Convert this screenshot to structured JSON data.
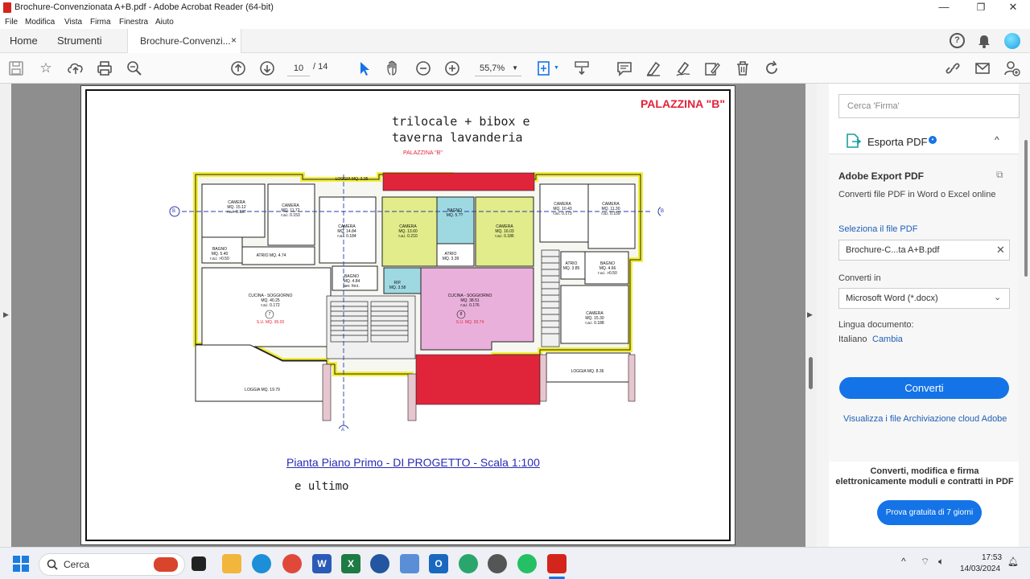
{
  "window": {
    "title": "Brochure-Convenzionata A+B.pdf - Adobe Acrobat Reader (64-bit)",
    "minimize": "—",
    "maximize": "❐",
    "close": "✕"
  },
  "menu": [
    "File",
    "Modifica",
    "Vista",
    "Firma",
    "Finestra",
    "Aiuto"
  ],
  "tabs": {
    "home": "Home",
    "tools": "Strumenti",
    "document": "Brochure-Convenzi...",
    "close": "×"
  },
  "toolbar": {
    "page_current": "10",
    "page_total": "/ 14",
    "zoom": "55,7%"
  },
  "document": {
    "heading_line1": "trilocale + bibox e",
    "heading_line2": "taverna lavanderia",
    "building_label": "PALAZZINA \"B\"",
    "building_label_small": "PALAZZINA \"B\"",
    "caption": "Pianta Piano Primo - DI PROGETTO  -  Scala 1:100",
    "caption_extra": "e ultimo",
    "section_marker_a": "A",
    "section_marker_b": "B",
    "rooms": [
      {
        "name": "CAMERA\nMQ. 15.12\nr.a.i. 0.137"
      },
      {
        "name": "CAMERA\nMQ. 11.72\nr.a.i. 0.153"
      },
      {
        "name": "CAMERA\nMQ. 14.84\nr.a.i. 0.184"
      },
      {
        "name": "CAMERA\nMQ. 13.60\nr.a.i. 0.210"
      },
      {
        "name": "BAGNO\nMQ. 5.??"
      },
      {
        "name": "CAMERA\nMQ. 16.03\nr.a.i. 0.186"
      },
      {
        "name": "CAMERA\nMQ. 10.43\nr.a.i. 0.173"
      },
      {
        "name": "CAMERA\nMQ. 11.30\nr.a.i. 0.159"
      },
      {
        "name": "BAGNO\nMQ. 5.40\nr.a.i. >0.50"
      },
      {
        "name": "ATRIO MQ. 4.74"
      },
      {
        "name": "BAGNO\nMQ. 4.84\naer. forz."
      },
      {
        "name": "RIP.\nMQ. 3.58"
      },
      {
        "name": "ATRIO\nMQ. 3.39"
      },
      {
        "name": "ATRIO\nMQ. 3.85"
      },
      {
        "name": "BAGNO\nMQ. 4.66\nr.a.i. >0.50"
      },
      {
        "name": "CUCINA - SOGGIORNO\nMQ. 40.25\nr.a.i. 0.172"
      },
      {
        "name": "CUCINA - SOGGIORNO\nMQ. 38.51\nr.a.i. 0.176"
      },
      {
        "name": "CAMERA\nMQ. 15.30\nr.a.i. 0.188"
      },
      {
        "name": "LOGGIA MQ. 19.79"
      },
      {
        "name": "LOGGIA MQ. 8.36"
      },
      {
        "name": "LOGGIA MQ. 3.35"
      }
    ],
    "unit_7": "7",
    "unit_8": "8",
    "su_7": "S.U. MQ. 95.00",
    "su_8": "S.U. MQ. 93.74"
  },
  "right_panel": {
    "search_placeholder": "Cerca 'Firma'",
    "export_title": "Esporta PDF",
    "adobe_export_title": "Adobe Export PDF",
    "adobe_export_desc": "Converti file PDF in Word o Excel online",
    "select_file_label": "Seleziona il file PDF",
    "selected_file": "Brochure-C...ta A+B.pdf",
    "convert_to_label": "Converti in",
    "convert_format": "Microsoft Word (*.docx)",
    "language_label": "Lingua documento:",
    "language_value": "Italiano",
    "language_change": "Cambia",
    "convert_button": "Converti",
    "cloud_link": "Visualizza i file Archiviazione cloud Adobe",
    "promo_text": "Converti, modifica e firma elettronicamente moduli e contratti in PDF",
    "trial_button": "Prova gratuita di 7 giorni"
  },
  "taskbar": {
    "search": "Cerca",
    "time": "17:53",
    "date": "14/03/2024"
  },
  "colors": {
    "accent": "#1473e6",
    "pdf_red": "#d4251c",
    "room_yellow": "#e2ec8a",
    "room_cyan": "#9ed9e2",
    "room_pink": "#eab0dc",
    "loggia_red": "#e0253a",
    "wall_yellow": "#f2ee3a"
  }
}
